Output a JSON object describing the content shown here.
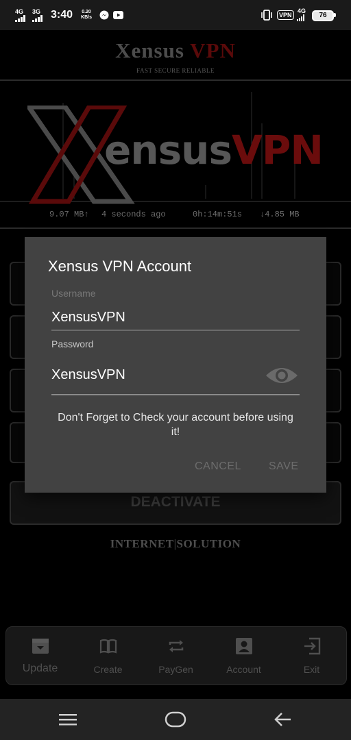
{
  "status_bar": {
    "net1": "4G",
    "net2": "3G",
    "time": "3:40",
    "speed_value": "0.20",
    "speed_unit": "KB/s",
    "vpn_badge": "VPN",
    "net3": "4G",
    "battery": "76"
  },
  "header": {
    "title_part1": "Xensus",
    "title_part2": "VPN",
    "tagline": "FAST SECURE RELIABLE"
  },
  "graph": {
    "logo_text_part1": "ensus",
    "logo_text_part2": "VPN"
  },
  "stats": {
    "upload": "9.07 MB",
    "last_update": "4 seconds ago",
    "duration": "0h:14m:51s",
    "download": "4.85 MB"
  },
  "behind": {
    "deactivate_label": "DEACTIVATE",
    "footer_part1": "INTERNET",
    "footer_part2": "SOLUTION"
  },
  "bottom_nav": {
    "items": [
      {
        "label": "Update",
        "icon": "archive-icon"
      },
      {
        "label": "Create",
        "icon": "book-icon"
      },
      {
        "label": "PayGen",
        "icon": "repeat-icon"
      },
      {
        "label": "Account",
        "icon": "account-box-icon"
      },
      {
        "label": "Exit",
        "icon": "exit-icon"
      }
    ]
  },
  "dialog": {
    "title": "Xensus VPN Account",
    "username_label": "Username",
    "username_value": "XensusVPN",
    "password_label": "Password",
    "password_value": "XensusVPN",
    "message": "Don't Forget to Check your account before using it!",
    "cancel_label": "CANCEL",
    "save_label": "SAVE"
  },
  "colors": {
    "accent_red": "#5a0a0a",
    "dialog_bg": "#424242",
    "status_bar_bg": "#1a1a1a"
  }
}
